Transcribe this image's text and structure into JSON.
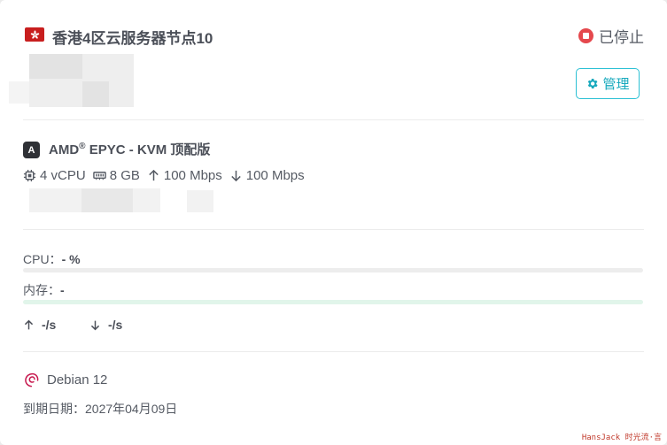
{
  "header": {
    "flag_icon": "hong-kong-flag-icon",
    "title": "香港4区云服务器节点10",
    "status_label": "已停止",
    "status_color": "#e5484d"
  },
  "actions": {
    "manage_label": "管理",
    "manage_icon": "gear-icon",
    "accent_color": "#17a9bd"
  },
  "spec": {
    "cpu_badge": "A",
    "cpu_name_prefix": "AMD",
    "cpu_name_sup": "®",
    "cpu_name_suffix": " EPYC - KVM 顶配版",
    "vcpu": "4 vCPU",
    "memory": "8 GB",
    "upload_bandwidth": "100 Mbps",
    "download_bandwidth": "100 Mbps"
  },
  "usage": {
    "cpu_label": "CPU：",
    "cpu_value": "- %",
    "cpu_percent": 0,
    "memory_label": "内存：",
    "memory_value": "-",
    "memory_percent": 0,
    "upload_rate": "-/s",
    "download_rate": "-/s"
  },
  "footer": {
    "os_icon": "debian-logo-icon",
    "os_name": "Debian 12",
    "expire_text": "到期日期：2027年04月09日",
    "watermark": "HansJack 时光流·言"
  }
}
